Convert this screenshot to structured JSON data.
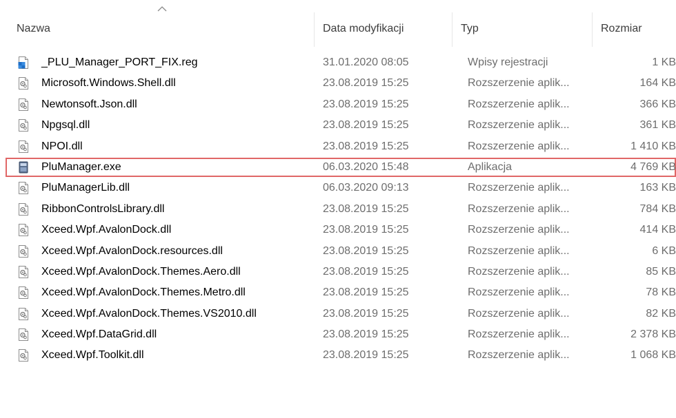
{
  "columns": {
    "name": "Nazwa",
    "date": "Data modyfikacji",
    "type": "Typ",
    "size": "Rozmiar"
  },
  "files": [
    {
      "name": "_PLU_Manager_PORT_FIX.reg",
      "date": "31.01.2020 08:05",
      "type": "Wpisy rejestracji",
      "size": "1 KB",
      "icon": "registry-file-icon"
    },
    {
      "name": "Microsoft.Windows.Shell.dll",
      "date": "23.08.2019 15:25",
      "type": "Rozszerzenie aplik...",
      "size": "164 KB",
      "icon": "dll-file-icon"
    },
    {
      "name": "Newtonsoft.Json.dll",
      "date": "23.08.2019 15:25",
      "type": "Rozszerzenie aplik...",
      "size": "366 KB",
      "icon": "dll-file-icon"
    },
    {
      "name": "Npgsql.dll",
      "date": "23.08.2019 15:25",
      "type": "Rozszerzenie aplik...",
      "size": "361 KB",
      "icon": "dll-file-icon"
    },
    {
      "name": "NPOI.dll",
      "date": "23.08.2019 15:25",
      "type": "Rozszerzenie aplik...",
      "size": "1 410 KB",
      "icon": "dll-file-icon"
    },
    {
      "name": "PluManager.exe",
      "date": "06.03.2020 15:48",
      "type": "Aplikacja",
      "size": "4 769 KB",
      "icon": "exe-file-icon"
    },
    {
      "name": "PluManagerLib.dll",
      "date": "06.03.2020 09:13",
      "type": "Rozszerzenie aplik...",
      "size": "163 KB",
      "icon": "dll-file-icon"
    },
    {
      "name": "RibbonControlsLibrary.dll",
      "date": "23.08.2019 15:25",
      "type": "Rozszerzenie aplik...",
      "size": "784 KB",
      "icon": "dll-file-icon"
    },
    {
      "name": "Xceed.Wpf.AvalonDock.dll",
      "date": "23.08.2019 15:25",
      "type": "Rozszerzenie aplik...",
      "size": "414 KB",
      "icon": "dll-file-icon"
    },
    {
      "name": "Xceed.Wpf.AvalonDock.resources.dll",
      "date": "23.08.2019 15:25",
      "type": "Rozszerzenie aplik...",
      "size": "6 KB",
      "icon": "dll-file-icon"
    },
    {
      "name": "Xceed.Wpf.AvalonDock.Themes.Aero.dll",
      "date": "23.08.2019 15:25",
      "type": "Rozszerzenie aplik...",
      "size": "85 KB",
      "icon": "dll-file-icon"
    },
    {
      "name": "Xceed.Wpf.AvalonDock.Themes.Metro.dll",
      "date": "23.08.2019 15:25",
      "type": "Rozszerzenie aplik...",
      "size": "78 KB",
      "icon": "dll-file-icon"
    },
    {
      "name": "Xceed.Wpf.AvalonDock.Themes.VS2010.dll",
      "date": "23.08.2019 15:25",
      "type": "Rozszerzenie aplik...",
      "size": "82 KB",
      "icon": "dll-file-icon"
    },
    {
      "name": "Xceed.Wpf.DataGrid.dll",
      "date": "23.08.2019 15:25",
      "type": "Rozszerzenie aplik...",
      "size": "2 378 KB",
      "icon": "dll-file-icon"
    },
    {
      "name": "Xceed.Wpf.Toolkit.dll",
      "date": "23.08.2019 15:25",
      "type": "Rozszerzenie aplik...",
      "size": "1 068 KB",
      "icon": "dll-file-icon"
    }
  ],
  "highlighted_file": "PluManager.exe",
  "colors": {
    "highlight_border": "#e06666",
    "secondary_text": "#6d6d6d"
  }
}
